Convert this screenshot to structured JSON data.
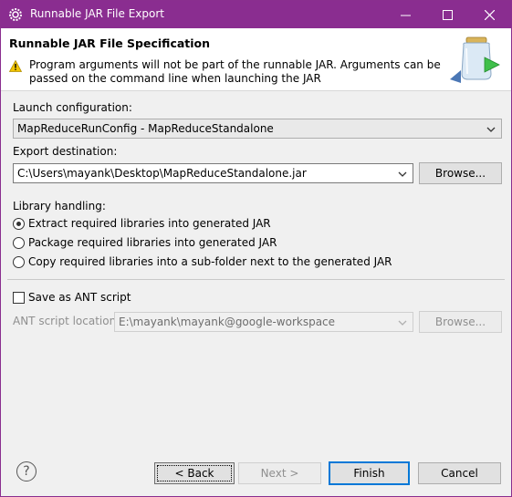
{
  "window": {
    "title": "Runnable JAR File Export",
    "controls": {
      "minimize": "—",
      "maximize": "☐",
      "close": "✕"
    },
    "title_bar_color": "#8a2d90"
  },
  "banner": {
    "heading": "Runnable JAR File Specification",
    "message": "Program arguments will not be part of the runnable JAR. Arguments can be passed on the command line when launching the JAR",
    "warning_icon": "warning-triangle-icon",
    "graphic_icon": "jar-export-wizard-icon"
  },
  "launch": {
    "label": "Launch configuration:",
    "value": "MapReduceRunConfig - MapReduceStandalone"
  },
  "export": {
    "label": "Export destination:",
    "value": "C:\\Users\\mayank\\Desktop\\MapReduceStandalone.jar",
    "browse": "Browse..."
  },
  "library": {
    "label": "Library handling:",
    "options": [
      {
        "label": "Extract required libraries into generated JAR",
        "selected": true
      },
      {
        "label": "Package required libraries into generated JAR",
        "selected": false
      },
      {
        "label": "Copy required libraries into a sub-folder next to the generated JAR",
        "selected": false
      }
    ]
  },
  "ant": {
    "checkbox_label": "Save as ANT script",
    "checked": false,
    "location_label": "ANT script location:",
    "location_value": "E:\\mayank\\mayank@google-workspace",
    "browse": "Browse..."
  },
  "footer": {
    "help": "?",
    "back": "< Back",
    "next": "Next >",
    "finish": "Finish",
    "cancel": "Cancel"
  }
}
